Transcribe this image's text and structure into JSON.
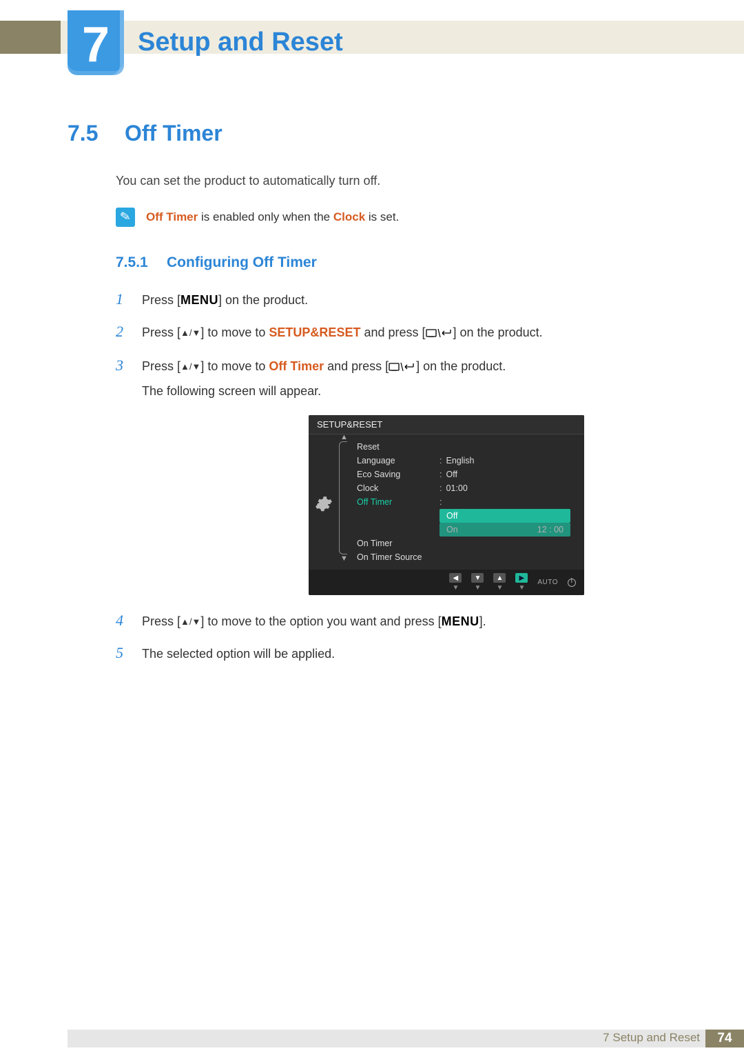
{
  "chapter": {
    "number": "7",
    "title": "Setup and Reset"
  },
  "section": {
    "number": "7.5",
    "title": "Off Timer"
  },
  "intro": "You can set the product to automatically turn off.",
  "note": {
    "prefix": "Off Timer",
    "mid": " is enabled only when the ",
    "clock": "Clock",
    "suffix": " is set."
  },
  "subsection": {
    "number": "7.5.1",
    "title": "Configuring Off Timer"
  },
  "labels": {
    "menu": "MENU",
    "updown": "▲/▼",
    "setup_reset": "SETUP&RESET",
    "off_timer": "Off Timer"
  },
  "steps": {
    "s1_a": "Press [",
    "s1_b": "] on the product.",
    "s2_a": "Press [",
    "s2_b": "] to move to ",
    "s2_c": " and press [",
    "s2_d": "] on the product.",
    "s3_a": "Press [",
    "s3_b": "] to move to ",
    "s3_c": " and press [",
    "s3_d": "] on the product.",
    "s3_sub": "The following screen will appear.",
    "s4_a": "Press [",
    "s4_b": "] to move to the option you want and press [",
    "s4_c": "].",
    "s5": "The selected option will be applied."
  },
  "step_nums": {
    "n1": "1",
    "n2": "2",
    "n3": "3",
    "n4": "4",
    "n5": "5"
  },
  "osd": {
    "title": "SETUP&RESET",
    "items": [
      {
        "label": "Reset",
        "value": ""
      },
      {
        "label": "Language",
        "value": "English"
      },
      {
        "label": "Eco Saving",
        "value": "Off"
      },
      {
        "label": "Clock",
        "value": "01:00"
      },
      {
        "label": "Off Timer",
        "value": "",
        "selected": true
      },
      {
        "label": "On Timer",
        "value": ""
      },
      {
        "label": "On Timer Source",
        "value": ""
      }
    ],
    "submenu": [
      {
        "label": "Off",
        "value": "",
        "highlight": true
      },
      {
        "label": "On",
        "value": "12 : 00"
      }
    ],
    "buttons": {
      "left": "◀",
      "down": "▼",
      "up": "▲",
      "right": "▶",
      "auto": "AUTO"
    }
  },
  "footer": {
    "chapter_label": "7 Setup and Reset",
    "page": "74"
  }
}
